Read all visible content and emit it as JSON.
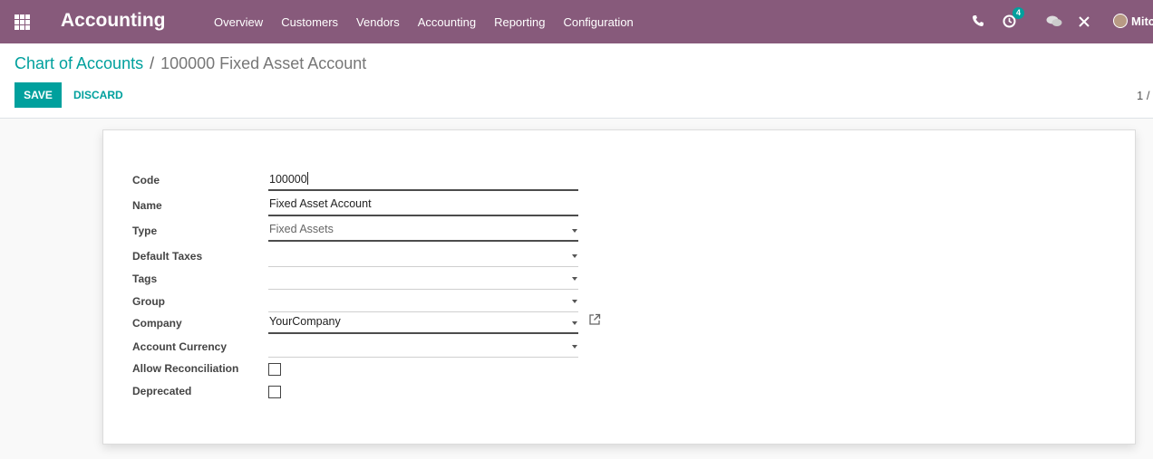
{
  "navbar": {
    "brand": "Accounting",
    "menu": [
      "Overview",
      "Customers",
      "Vendors",
      "Accounting",
      "Reporting",
      "Configuration"
    ],
    "activity_badge": "4",
    "user_name": "Mitc",
    "color": "#875a7b"
  },
  "breadcrumb": {
    "parent": "Chart of Accounts",
    "separator": "/",
    "current": "100000 Fixed Asset Account"
  },
  "buttons": {
    "save": "SAVE",
    "discard": "DISCARD"
  },
  "pager": "1 /",
  "form": {
    "code": {
      "label": "Code",
      "value": "100000"
    },
    "name": {
      "label": "Name",
      "value": "Fixed Asset Account"
    },
    "type": {
      "label": "Type",
      "value": "Fixed Assets"
    },
    "default_taxes": {
      "label": "Default Taxes",
      "value": ""
    },
    "tags": {
      "label": "Tags",
      "value": ""
    },
    "group": {
      "label": "Group",
      "value": ""
    },
    "company": {
      "label": "Company",
      "value": "YourCompany"
    },
    "account_currency": {
      "label": "Account Currency",
      "value": ""
    },
    "allow_reconciliation": {
      "label": "Allow Reconciliation",
      "checked": false
    },
    "deprecated": {
      "label": "Deprecated",
      "checked": false
    }
  },
  "colors": {
    "accent": "#00a09d",
    "navbar": "#875a7b"
  }
}
